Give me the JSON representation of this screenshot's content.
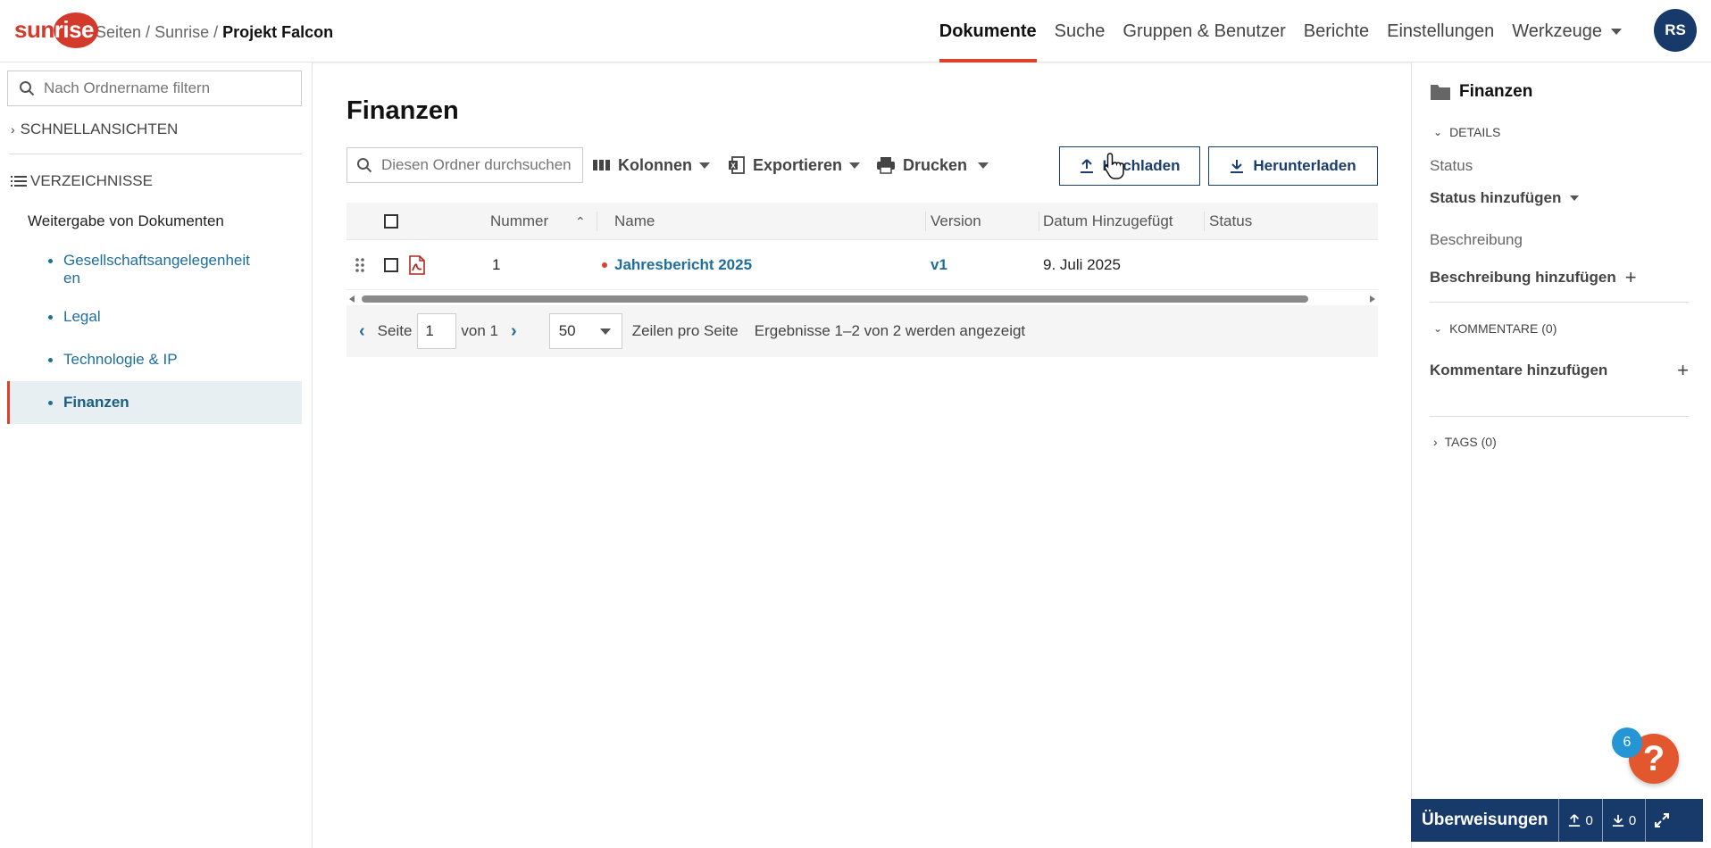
{
  "header": {
    "logo_text_a": "sun",
    "logo_text_b": "rise",
    "breadcrumb": [
      "Seiten",
      "Sunrise",
      "Projekt Falcon"
    ],
    "nav": [
      {
        "label": "Dokumente",
        "active": true
      },
      {
        "label": "Suche"
      },
      {
        "label": "Gruppen & Benutzer"
      },
      {
        "label": "Berichte"
      },
      {
        "label": "Einstellungen"
      },
      {
        "label": "Werkzeuge",
        "has_dropdown": true
      }
    ],
    "avatar_initials": "RS",
    "accent_color": "#d9432e",
    "brand_color": "#173a6a"
  },
  "sidebar": {
    "filter_placeholder": "Nach Ordnername filtern",
    "quick_views": "SCHNELLANSICHTEN",
    "directories": "VERZEICHNISSE",
    "root": "Weitergabe von Dokumenten",
    "items": [
      {
        "label": "Gesellschaftsangelegenheit",
        "label_wrap": "en"
      },
      {
        "label": "Legal"
      },
      {
        "label": "Technologie & IP"
      },
      {
        "label": "Finanzen",
        "active": true
      }
    ]
  },
  "main": {
    "title": "Finanzen",
    "search_placeholder": "Diesen Ordner durchsuchen",
    "toolbar": {
      "columns": "Kolonnen",
      "export": "Exportieren",
      "print": "Drucken",
      "upload": "Hochladen",
      "download": "Herunterladen"
    },
    "table": {
      "headers": {
        "number": "Nummer",
        "name": "Name",
        "version": "Version",
        "date": "Datum Hinzugefügt",
        "status": "Status"
      },
      "rows": [
        {
          "number": "1",
          "name": "Jahresbericht 2025",
          "version": "v1",
          "date": "9. Juli 2025",
          "status": ""
        }
      ]
    },
    "pager": {
      "page_label": "Seite",
      "page_value": "1",
      "of_label": "von 1",
      "rows_value": "50",
      "rows_label": "Zeilen pro Seite",
      "results": "Ergebnisse 1–2 von 2 werden angezeigt"
    }
  },
  "right_panel": {
    "title": "Finanzen",
    "details": "DETAILS",
    "status_label": "Status",
    "status_action": "Status hinzufügen",
    "description_label": "Beschreibung",
    "description_action": "Beschreibung hinzufügen",
    "comments": "KOMMENTARE (0)",
    "comments_action": "Kommentare hinzufügen",
    "tags": "TAGS (0)"
  },
  "help": {
    "badge": "6",
    "symbol": "?"
  },
  "transfers": {
    "label": "Überweisungen",
    "uploads": "0",
    "downloads": "0"
  }
}
